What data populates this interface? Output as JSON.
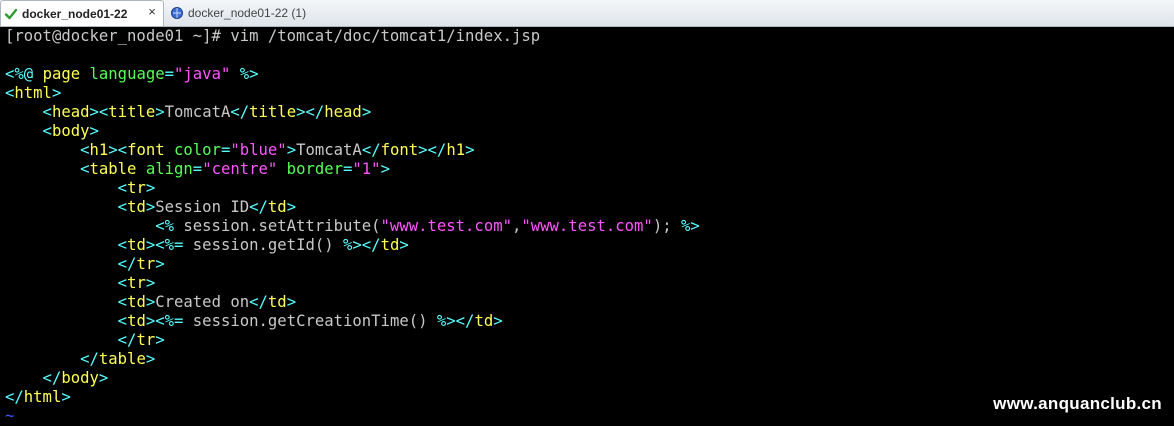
{
  "tabs": [
    {
      "label": "docker_node01-22",
      "active": true,
      "icon": "check-icon",
      "close": "×"
    },
    {
      "label": "docker_node01-22 (1)",
      "active": false,
      "icon": "terminal-globe-icon"
    }
  ],
  "terminal": {
    "prompt_line": "[root@docker_node01 ~]# vim /tomcat/doc/tomcat1/index.jsp",
    "lines": [
      {
        "parts": [
          {
            "t": "<%@ ",
            "c": "t"
          },
          {
            "t": "page ",
            "c": "y"
          },
          {
            "t": "language",
            "c": "g"
          },
          {
            "t": "=",
            "c": "t"
          },
          {
            "t": "\"java\"",
            "c": "s"
          },
          {
            "t": " %>",
            "c": "t"
          }
        ]
      },
      {
        "parts": [
          {
            "t": "<",
            "c": "t"
          },
          {
            "t": "html",
            "c": "y"
          },
          {
            "t": ">",
            "c": "t"
          }
        ]
      },
      {
        "parts": [
          {
            "t": "    <",
            "c": "t"
          },
          {
            "t": "head",
            "c": "y"
          },
          {
            "t": "><",
            "c": "t"
          },
          {
            "t": "title",
            "c": "y"
          },
          {
            "t": ">",
            "c": "t"
          },
          {
            "t": "TomcatA",
            "c": "c"
          },
          {
            "t": "</",
            "c": "t"
          },
          {
            "t": "title",
            "c": "y"
          },
          {
            "t": "></",
            "c": "t"
          },
          {
            "t": "head",
            "c": "y"
          },
          {
            "t": ">",
            "c": "t"
          }
        ]
      },
      {
        "parts": [
          {
            "t": "    <",
            "c": "t"
          },
          {
            "t": "body",
            "c": "y"
          },
          {
            "t": ">",
            "c": "t"
          }
        ]
      },
      {
        "parts": [
          {
            "t": "        <",
            "c": "t"
          },
          {
            "t": "h1",
            "c": "y"
          },
          {
            "t": "><",
            "c": "t"
          },
          {
            "t": "font",
            "c": "y"
          },
          {
            "t": " color",
            "c": "g"
          },
          {
            "t": "=",
            "c": "t"
          },
          {
            "t": "\"blue\"",
            "c": "s"
          },
          {
            "t": ">",
            "c": "t"
          },
          {
            "t": "TomcatA",
            "c": "c"
          },
          {
            "t": "</",
            "c": "t"
          },
          {
            "t": "font",
            "c": "y"
          },
          {
            "t": "></",
            "c": "t"
          },
          {
            "t": "h1",
            "c": "y"
          },
          {
            "t": ">",
            "c": "t"
          }
        ]
      },
      {
        "parts": [
          {
            "t": "        <",
            "c": "t"
          },
          {
            "t": "table",
            "c": "y"
          },
          {
            "t": " align",
            "c": "g"
          },
          {
            "t": "=",
            "c": "t"
          },
          {
            "t": "\"centre\"",
            "c": "s"
          },
          {
            "t": " border",
            "c": "g"
          },
          {
            "t": "=",
            "c": "t"
          },
          {
            "t": "\"1\"",
            "c": "s"
          },
          {
            "t": ">",
            "c": "t"
          }
        ]
      },
      {
        "parts": [
          {
            "t": "            <",
            "c": "t"
          },
          {
            "t": "tr",
            "c": "y"
          },
          {
            "t": ">",
            "c": "t"
          }
        ]
      },
      {
        "parts": [
          {
            "t": "            <",
            "c": "t"
          },
          {
            "t": "td",
            "c": "y"
          },
          {
            "t": ">",
            "c": "t"
          },
          {
            "t": "Session ID",
            "c": "c"
          },
          {
            "t": "</",
            "c": "t"
          },
          {
            "t": "td",
            "c": "y"
          },
          {
            "t": ">",
            "c": "t"
          }
        ]
      },
      {
        "parts": [
          {
            "t": "                <%",
            "c": "t"
          },
          {
            "t": " session.setAttribute(",
            "c": "c"
          },
          {
            "t": "\"www.test.com\"",
            "c": "s"
          },
          {
            "t": ",",
            "c": "c"
          },
          {
            "t": "\"www.test.com\"",
            "c": "s"
          },
          {
            "t": "); ",
            "c": "c"
          },
          {
            "t": "%>",
            "c": "t"
          }
        ]
      },
      {
        "parts": [
          {
            "t": "            <",
            "c": "t"
          },
          {
            "t": "td",
            "c": "y"
          },
          {
            "t": "><%=",
            "c": "t"
          },
          {
            "t": " session.getId() ",
            "c": "c"
          },
          {
            "t": "%></",
            "c": "t"
          },
          {
            "t": "td",
            "c": "y"
          },
          {
            "t": ">",
            "c": "t"
          }
        ]
      },
      {
        "parts": [
          {
            "t": "            </",
            "c": "t"
          },
          {
            "t": "tr",
            "c": "y"
          },
          {
            "t": ">",
            "c": "t"
          }
        ]
      },
      {
        "parts": [
          {
            "t": "            <",
            "c": "t"
          },
          {
            "t": "tr",
            "c": "y"
          },
          {
            "t": ">",
            "c": "t"
          }
        ]
      },
      {
        "parts": [
          {
            "t": "            <",
            "c": "t"
          },
          {
            "t": "td",
            "c": "y"
          },
          {
            "t": ">",
            "c": "t"
          },
          {
            "t": "Created on",
            "c": "c"
          },
          {
            "t": "</",
            "c": "t"
          },
          {
            "t": "td",
            "c": "y"
          },
          {
            "t": ">",
            "c": "t"
          }
        ]
      },
      {
        "parts": [
          {
            "t": "            <",
            "c": "t"
          },
          {
            "t": "td",
            "c": "y"
          },
          {
            "t": "><%=",
            "c": "t"
          },
          {
            "t": " session.getCreationTime() ",
            "c": "c"
          },
          {
            "t": "%></",
            "c": "t"
          },
          {
            "t": "td",
            "c": "y"
          },
          {
            "t": ">",
            "c": "t"
          }
        ]
      },
      {
        "parts": [
          {
            "t": "            </",
            "c": "t"
          },
          {
            "t": "tr",
            "c": "y"
          },
          {
            "t": ">",
            "c": "t"
          }
        ]
      },
      {
        "parts": [
          {
            "t": "        </",
            "c": "t"
          },
          {
            "t": "table",
            "c": "y"
          },
          {
            "t": ">",
            "c": "t"
          }
        ]
      },
      {
        "parts": [
          {
            "t": "    </",
            "c": "t"
          },
          {
            "t": "body",
            "c": "y"
          },
          {
            "t": ">",
            "c": "t"
          }
        ]
      },
      {
        "parts": [
          {
            "t": "</",
            "c": "t"
          },
          {
            "t": "html",
            "c": "y"
          },
          {
            "t": ">",
            "c": "t"
          }
        ]
      }
    ],
    "tilde": "~"
  },
  "watermark": "www.anquanclub.cn",
  "colors": {
    "background": "#000000",
    "text": "#c8c8c8",
    "tag_name": "#ffff55",
    "tag_bracket": "#55ffff",
    "string": "#ff55ff",
    "attribute": "#55ff55",
    "tilde": "#3a5aff"
  }
}
